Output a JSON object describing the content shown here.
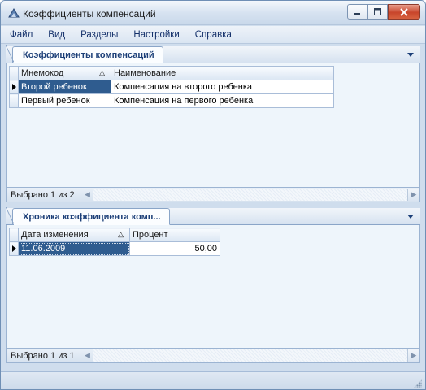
{
  "window": {
    "title": "Коэффициенты компенсаций"
  },
  "menu": {
    "items": [
      "Файл",
      "Вид",
      "Разделы",
      "Настройки",
      "Справка"
    ]
  },
  "top_panel": {
    "tab_label": "Коэффициенты компенсаций",
    "columns": [
      "Мнемокод",
      "Наименование"
    ],
    "sorted_column": "Мнемокод",
    "rows": [
      {
        "code": "Второй ребенок",
        "name": "Компенсация на второго ребенка",
        "selected": true
      },
      {
        "code": "Первый ребенок",
        "name": "Компенсация на первого ребенка",
        "selected": false
      }
    ],
    "status": "Выбрано 1 из 2"
  },
  "bottom_panel": {
    "tab_label": "Хроника коэффициента комп...",
    "columns": [
      "Дата изменения",
      "Процент"
    ],
    "sorted_column": "Дата изменения",
    "rows": [
      {
        "date": "11.06.2009",
        "percent": "50,00",
        "selected": true
      }
    ],
    "status": "Выбрано 1 из 1"
  },
  "icons": {
    "app": "app-icon",
    "minimize": "minimize-icon",
    "maximize": "maximize-icon",
    "close": "close-icon",
    "sort": "sort-ascending-icon",
    "row_pointer": "row-pointer-icon",
    "panel_menu": "chevron-down-icon",
    "scroll_left": "scroll-left-icon",
    "scroll_right": "scroll-right-icon"
  },
  "colors": {
    "window_bg": "#cfdded",
    "selection": "#2f5c8f",
    "tab_text": "#1c3f78",
    "close_button": "#c8452b"
  }
}
